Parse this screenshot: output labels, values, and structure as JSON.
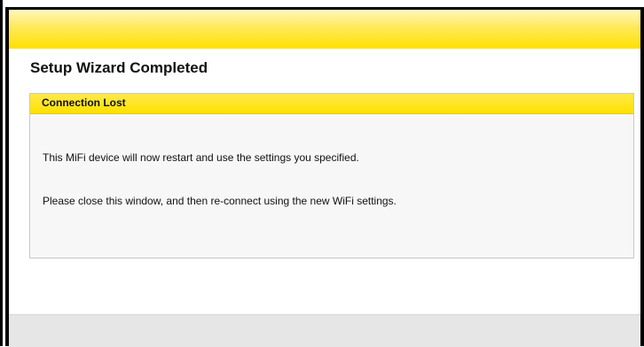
{
  "page": {
    "title": "Setup Wizard Completed"
  },
  "panel": {
    "title": "Connection Lost",
    "messages": [
      "This MiFi device will now restart and use the settings you specified.",
      "Please close this window, and then re-connect using the new WiFi settings."
    ]
  },
  "colors": {
    "accent": "#ffe100",
    "panel_bg": "#f7f7f7",
    "footer_bg": "#e6e6e6"
  }
}
